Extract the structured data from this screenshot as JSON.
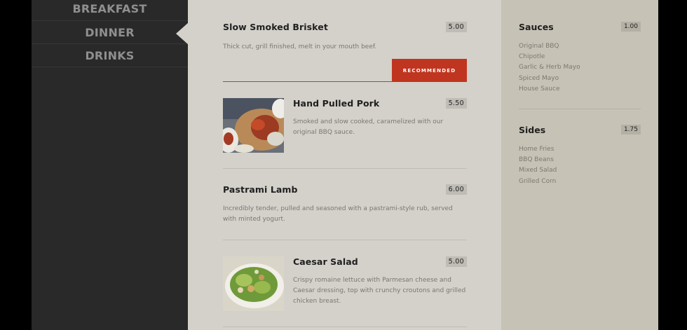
{
  "nav": {
    "items": [
      {
        "label": "BREAKFAST"
      },
      {
        "label": "DINNER"
      },
      {
        "label": "DRINKS"
      }
    ],
    "active": "DINNER"
  },
  "menu": {
    "items": [
      {
        "title": "Slow Smoked Brisket",
        "price": "5.00",
        "desc": "Thick cut, grill finished, melt in your mouth beef.",
        "badge": "RECOMMENDED"
      },
      {
        "title": "Hand Pulled Pork",
        "price": "5.50",
        "desc": "Smoked and slow cooked, caramelized with our original BBQ sauce.",
        "image": "pulled-pork-photo"
      },
      {
        "title": "Pastrami Lamb",
        "price": "6.00",
        "desc": "Incredibly tender, pulled and seasoned with a pastrami-style rub, served with minted yogurt."
      },
      {
        "title": "Caesar Salad",
        "price": "5.00",
        "desc": "Crispy romaine lettuce with Parmesan cheese and Caesar dressing, top with crunchy croutons and grilled chicken breast.",
        "image": "caesar-salad-photo"
      }
    ]
  },
  "sides": {
    "groups": [
      {
        "title": "Sauces",
        "price": "1.00",
        "items": [
          "Original BBQ",
          "Chipotle",
          "Garlic & Herb Mayo",
          "Spiced Mayo",
          "House Sauce"
        ]
      },
      {
        "title": "Sides",
        "price": "1.75",
        "items": [
          "Home Fries",
          "BBQ Beans",
          "Mixed Salad",
          "Grilled Corn"
        ]
      }
    ]
  },
  "colors": {
    "accent": "#c0351f",
    "sidebar_bg": "#292929",
    "main_bg": "#d4d1cb",
    "side_bg": "#c6c2b6"
  }
}
